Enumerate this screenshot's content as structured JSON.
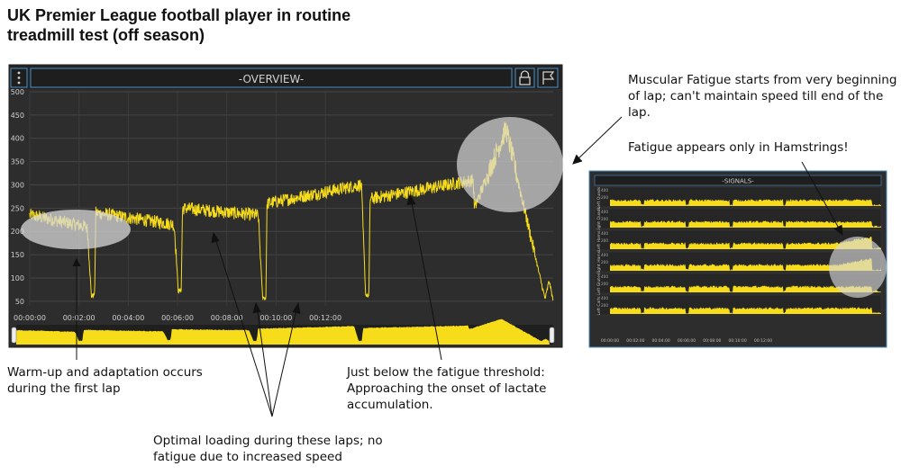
{
  "title": "UK Premier League football player in routine treadmill test (off season)",
  "overview": {
    "title": "-OVERVIEW-",
    "menu_icon": "vertical-dots-icon",
    "lock_icon": "lock-icon",
    "flag_icon": "flag-icon"
  },
  "signals": {
    "title": "-SIGNALS-",
    "rows": [
      "Left Quads",
      "Right Quads",
      "Left Hams",
      "Right Hams",
      "Left Glutes",
      "Left Calfs"
    ],
    "row_ticks": [
      "400",
      "200"
    ],
    "x_ticks": [
      "00:00:00",
      "00:02:00",
      "00:04:00",
      "00:06:00",
      "00:08:00",
      "00:10:00",
      "00:12:00"
    ]
  },
  "annotations": {
    "warmup": "Warm-up and adaptation occurs during the first lap",
    "threshold": "Just below the fatigue threshold: Approaching the onset of lactate accumulation.",
    "optimal": "Optimal loading during these laps; no fatigue due to increased speed",
    "muscular": "Muscular Fatigue starts from very beginning of lap; can't maintain speed till end of the lap.",
    "hamstrings": "Fatigue appears only in Hamstrings!"
  },
  "colors": {
    "signal": "#f7dc1a",
    "panel_bg": "#2d2d2d",
    "panel_border": "#4a90c8",
    "highlight": "#d8d8d8"
  },
  "chart_data": {
    "type": "line",
    "title": "",
    "xlabel": "",
    "ylabel": "",
    "x_ticks": [
      "00:00:00",
      "00:02:00",
      "00:04:00",
      "00:06:00",
      "00:08:00",
      "00:10:00",
      "00:12:00"
    ],
    "y_ticks": [
      "500",
      "450",
      "400",
      "350",
      "300",
      "250",
      "200",
      "150",
      "100",
      "50"
    ],
    "xlim": [
      "00:00:00",
      "00:13:15"
    ],
    "ylim": [
      40,
      500
    ],
    "grid": true,
    "series": [
      {
        "name": "",
        "x_seconds": [
          0,
          138,
          141,
          150,
          158,
          161,
          350,
          353,
          362,
          369,
          372,
          554,
          557,
          567,
          575,
          578,
          805,
          808,
          818,
          826,
          829,
          1080,
          1083,
          1160,
          1163,
          1255,
          1258,
          1265,
          1275
        ],
        "values": [
          235,
          210,
          200,
          60,
          65,
          240,
          215,
          200,
          70,
          75,
          250,
          235,
          230,
          60,
          55,
          260,
          300,
          295,
          65,
          60,
          270,
          310,
          250,
          420,
          410,
          55,
          65,
          95,
          50
        ]
      }
    ]
  }
}
